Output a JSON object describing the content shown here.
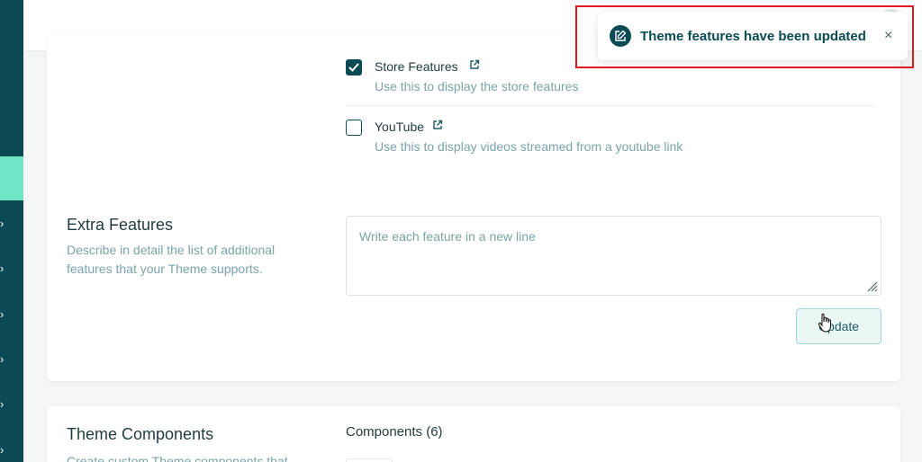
{
  "toast": {
    "message": "Theme features have been updated",
    "close": "×"
  },
  "features": {
    "items": [
      {
        "title": "Store Features",
        "description": "Use this to display the store features",
        "checked": true
      },
      {
        "title": "YouTube",
        "description": "Use this to display videos streamed from a youtube link",
        "checked": false
      }
    ]
  },
  "extra_features": {
    "title": "Extra Features",
    "description": "Describe in detail the list of additional features that your Theme supports.",
    "placeholder": "Write each feature in a new line",
    "update_label": "Update"
  },
  "theme_components": {
    "title": "Theme Components",
    "description": "Create custom Theme components that",
    "components_label": "Components (6)"
  },
  "colors": {
    "sidebar": "#0a4a55",
    "sidebar_active": "#6ee6c6",
    "accent": "#0a4a55",
    "muted_text": "#7aa3a8",
    "highlight_border": "#e0191e"
  },
  "icons": [
    "chevron-right-icon",
    "check-icon",
    "external-link-icon",
    "edit-icon",
    "close-icon",
    "resize-grip-icon",
    "hand-cursor-icon"
  ]
}
